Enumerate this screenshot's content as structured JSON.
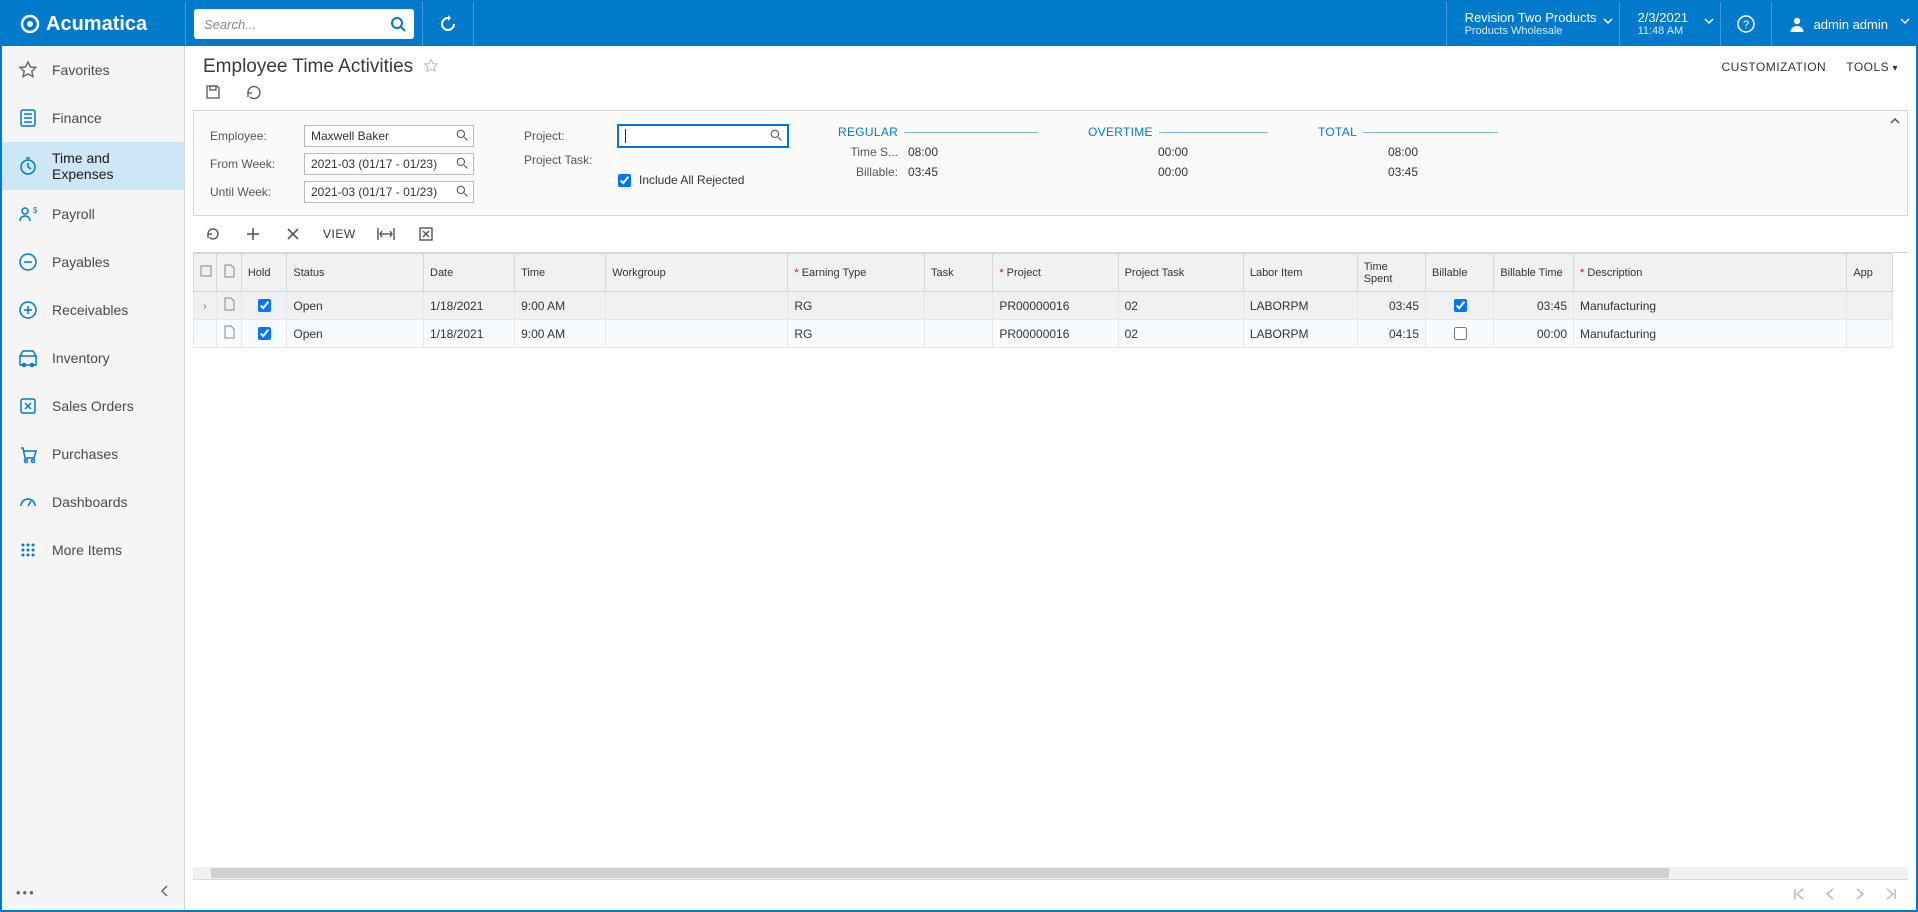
{
  "brand": "Acumatica",
  "search": {
    "placeholder": "Search..."
  },
  "company": {
    "line1": "Revision Two Products",
    "line2": "Products Wholesale"
  },
  "datetime": {
    "line1": "2/3/2021",
    "line2": "11:48 AM"
  },
  "user": {
    "name": "admin admin"
  },
  "sidebar": {
    "items": [
      {
        "label": "Favorites"
      },
      {
        "label": "Finance"
      },
      {
        "label": "Time and Expenses"
      },
      {
        "label": "Payroll"
      },
      {
        "label": "Payables"
      },
      {
        "label": "Receivables"
      },
      {
        "label": "Inventory"
      },
      {
        "label": "Sales Orders"
      },
      {
        "label": "Purchases"
      },
      {
        "label": "Dashboards"
      },
      {
        "label": "More Items"
      }
    ]
  },
  "page": {
    "title": "Employee Time Activities",
    "actions": {
      "customization": "CUSTOMIZATION",
      "tools": "TOOLS"
    }
  },
  "form": {
    "labels": {
      "employee": "Employee:",
      "fromWeek": "From Week:",
      "untilWeek": "Until Week:",
      "project": "Project:",
      "projectTask": "Project Task:",
      "includeRejected": "Include All Rejected"
    },
    "values": {
      "employee": "Maxwell Baker",
      "fromWeek": "2021-03 (01/17 - 01/23)",
      "untilWeek": "2021-03 (01/17 - 01/23)",
      "project": "",
      "projectTask": "",
      "includeRejected": true
    },
    "sections": {
      "regular": {
        "title": "REGULAR",
        "timeSpentLabel": "Time S...",
        "timeSpent": "08:00",
        "billableLabel": "Billable:",
        "billable": "03:45"
      },
      "overtime": {
        "title": "OVERTIME",
        "timeSpent": "00:00",
        "billable": "00:00"
      },
      "total": {
        "title": "TOTAL",
        "timeSpent": "08:00",
        "billable": "03:45"
      }
    }
  },
  "gridtoolbar": {
    "view": "VIEW"
  },
  "grid": {
    "headers": {
      "hold": "Hold",
      "status": "Status",
      "date": "Date",
      "time": "Time",
      "workgroup": "Workgroup",
      "earningType": "Earning Type",
      "task": "Task",
      "project": "Project",
      "projectTask": "Project Task",
      "laborItem": "Labor Item",
      "timeSpent": "Time Spent",
      "billable": "Billable",
      "billableTime": "Billable Time",
      "description": "Description",
      "approver": "App"
    },
    "rows": [
      {
        "hold": true,
        "status": "Open",
        "date": "1/18/2021",
        "time": "9:00 AM",
        "workgroup": "",
        "earningType": "RG",
        "task": "",
        "project": "PR00000016",
        "projectTask": "02",
        "laborItem": "LABORPM",
        "timeSpent": "03:45",
        "billable": true,
        "billableTime": "03:45",
        "description": "Manufacturing"
      },
      {
        "hold": true,
        "status": "Open",
        "date": "1/18/2021",
        "time": "9:00 AM",
        "workgroup": "",
        "earningType": "RG",
        "task": "",
        "project": "PR00000016",
        "projectTask": "02",
        "laborItem": "LABORPM",
        "timeSpent": "04:15",
        "billable": false,
        "billableTime": "00:00",
        "description": "Manufacturing"
      }
    ]
  }
}
